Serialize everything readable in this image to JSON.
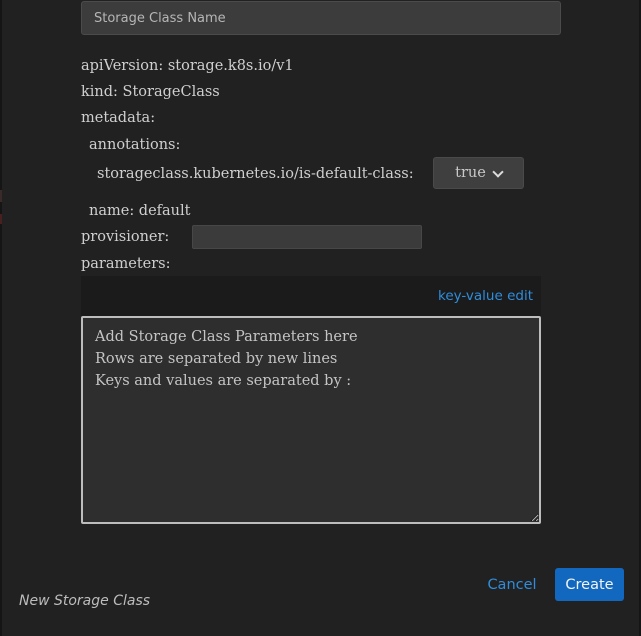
{
  "form": {
    "name_placeholder": "Storage Class Name",
    "yaml": {
      "api_version": "apiVersion: storage.k8s.io/v1",
      "kind": "kind: StorageClass",
      "metadata": "metadata:",
      "annotations": "annotations:",
      "default_class_key": "storageclass.kubernetes.io/is-default-class:",
      "default_class_value": "true",
      "name": "name: default",
      "provisioner": "provisioner:",
      "parameters": "parameters:"
    },
    "provisioner_value": "",
    "key_value_edit_link": "key-value edit",
    "parameters_placeholder": "Add Storage Class Parameters here\nRows are separated by new lines\nKeys and values are separated by :"
  },
  "footer": {
    "title": "New Storage Class",
    "cancel_label": "Cancel",
    "create_label": "Create"
  },
  "colors": {
    "background": "#212121",
    "accent": "#2f8ddb",
    "primary_button": "#1268be",
    "text": "#cfcfcf"
  }
}
